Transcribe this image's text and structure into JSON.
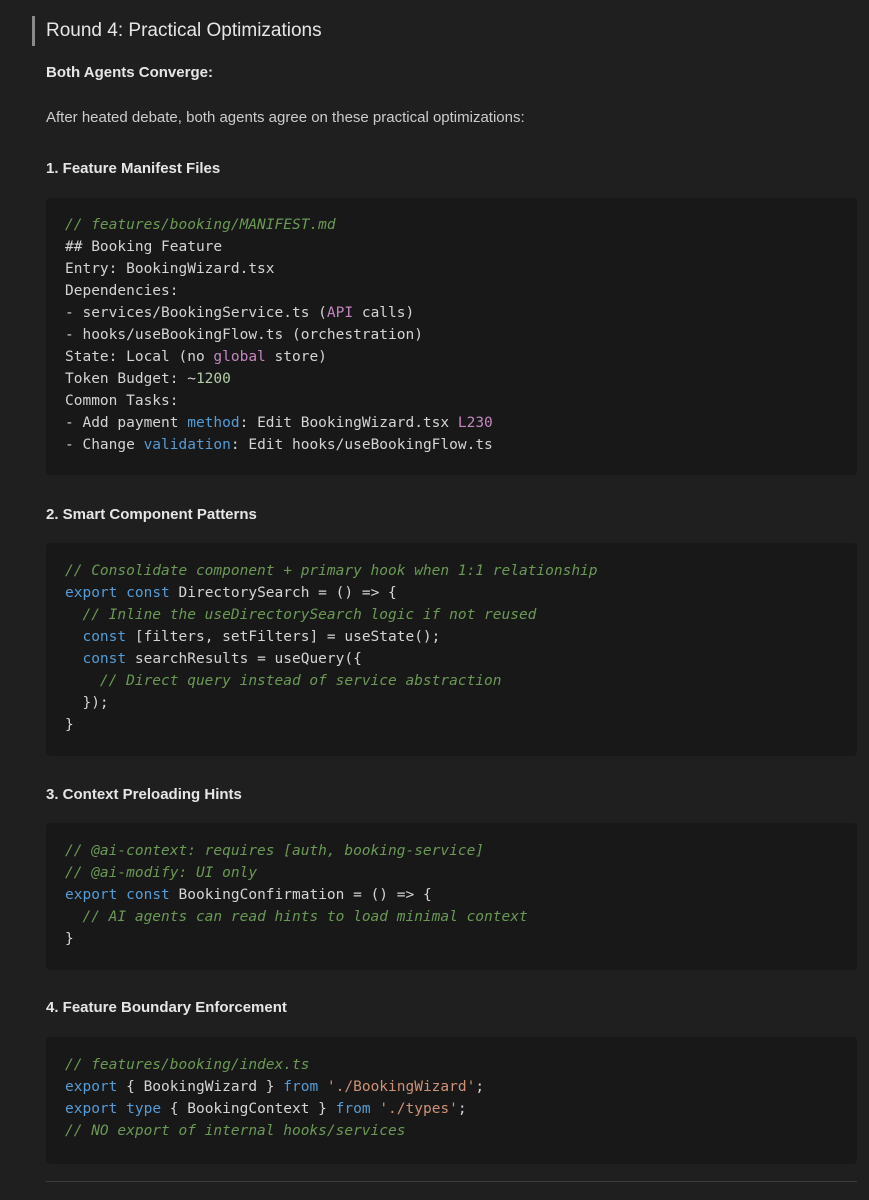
{
  "heading": "Round 4: Practical Optimizations",
  "intro": {
    "subheading": "Both Agents Converge:",
    "paragraph": "After heated debate, both agents agree on these practical optimizations:"
  },
  "sections": [
    {
      "title": "1. Feature Manifest Files",
      "code": [
        [
          {
            "t": "// features/booking/MANIFEST.md",
            "c": "c"
          }
        ],
        [
          {
            "t": "## Booking Feature",
            "c": "t"
          }
        ],
        [
          {
            "t": "Entry: BookingWizard.tsx",
            "c": "t"
          }
        ],
        [
          {
            "t": "Dependencies:",
            "c": "t"
          }
        ],
        [
          {
            "t": "- services/BookingService.ts (",
            "c": "t"
          },
          {
            "t": "API",
            "c": "p"
          },
          {
            "t": " calls)",
            "c": "t"
          }
        ],
        [
          {
            "t": "- hooks/useBookingFlow.ts (orchestration)",
            "c": "t"
          }
        ],
        [
          {
            "t": "State: Local (no ",
            "c": "t"
          },
          {
            "t": "global",
            "c": "p"
          },
          {
            "t": " store)",
            "c": "t"
          }
        ],
        [
          {
            "t": "Token Budget: ~",
            "c": "t"
          },
          {
            "t": "1200",
            "c": "n"
          }
        ],
        [
          {
            "t": "Common Tasks:",
            "c": "t"
          }
        ],
        [
          {
            "t": "- Add payment ",
            "c": "t"
          },
          {
            "t": "method",
            "c": "k"
          },
          {
            "t": ": Edit BookingWizard.tsx ",
            "c": "t"
          },
          {
            "t": "L230",
            "c": "p"
          }
        ],
        [
          {
            "t": "- Change ",
            "c": "t"
          },
          {
            "t": "validation",
            "c": "k"
          },
          {
            "t": ": Edit hooks/useBookingFlow.ts",
            "c": "t"
          }
        ]
      ]
    },
    {
      "title": "2. Smart Component Patterns",
      "code": [
        [
          {
            "t": "// Consolidate component + primary hook when 1:1 relationship",
            "c": "c"
          }
        ],
        [
          {
            "t": "export",
            "c": "k"
          },
          {
            "t": " ",
            "c": "t"
          },
          {
            "t": "const",
            "c": "k"
          },
          {
            "t": " DirectorySearch = () => {",
            "c": "t"
          }
        ],
        [
          {
            "t": "  ",
            "c": "t"
          },
          {
            "t": "// Inline the useDirectorySearch logic if not reused",
            "c": "c"
          }
        ],
        [
          {
            "t": "  ",
            "c": "t"
          },
          {
            "t": "const",
            "c": "k"
          },
          {
            "t": " [filters, setFilters] = useState();",
            "c": "t"
          }
        ],
        [
          {
            "t": "  ",
            "c": "t"
          },
          {
            "t": "const",
            "c": "k"
          },
          {
            "t": " searchResults = useQuery({",
            "c": "t"
          }
        ],
        [
          {
            "t": "    ",
            "c": "t"
          },
          {
            "t": "// Direct query instead of service abstraction",
            "c": "c"
          }
        ],
        [
          {
            "t": "  });",
            "c": "t"
          }
        ],
        [
          {
            "t": "}",
            "c": "t"
          }
        ]
      ]
    },
    {
      "title": "3. Context Preloading Hints",
      "code": [
        [
          {
            "t": "// @ai-context: requires [auth, booking-service]",
            "c": "c"
          }
        ],
        [
          {
            "t": "// @ai-modify: UI only",
            "c": "c"
          }
        ],
        [
          {
            "t": "export",
            "c": "k"
          },
          {
            "t": " ",
            "c": "t"
          },
          {
            "t": "const",
            "c": "k"
          },
          {
            "t": " BookingConfirmation = () => {",
            "c": "t"
          }
        ],
        [
          {
            "t": "  ",
            "c": "t"
          },
          {
            "t": "// AI agents can read hints to load minimal context",
            "c": "c"
          }
        ],
        [
          {
            "t": "}",
            "c": "t"
          }
        ]
      ]
    },
    {
      "title": "4. Feature Boundary Enforcement",
      "code": [
        [
          {
            "t": "// features/booking/index.ts",
            "c": "c"
          }
        ],
        [
          {
            "t": "export",
            "c": "k"
          },
          {
            "t": " { BookingWizard } ",
            "c": "t"
          },
          {
            "t": "from",
            "c": "k"
          },
          {
            "t": " ",
            "c": "t"
          },
          {
            "t": "'./BookingWizard'",
            "c": "s"
          },
          {
            "t": ";",
            "c": "t"
          }
        ],
        [
          {
            "t": "export",
            "c": "k"
          },
          {
            "t": " ",
            "c": "t"
          },
          {
            "t": "type",
            "c": "k"
          },
          {
            "t": " { BookingContext } ",
            "c": "t"
          },
          {
            "t": "from",
            "c": "k"
          },
          {
            "t": " ",
            "c": "t"
          },
          {
            "t": "'./types'",
            "c": "s"
          },
          {
            "t": ";",
            "c": "t"
          }
        ],
        [
          {
            "t": "// NO export of internal hooks/services",
            "c": "c"
          }
        ]
      ]
    }
  ]
}
